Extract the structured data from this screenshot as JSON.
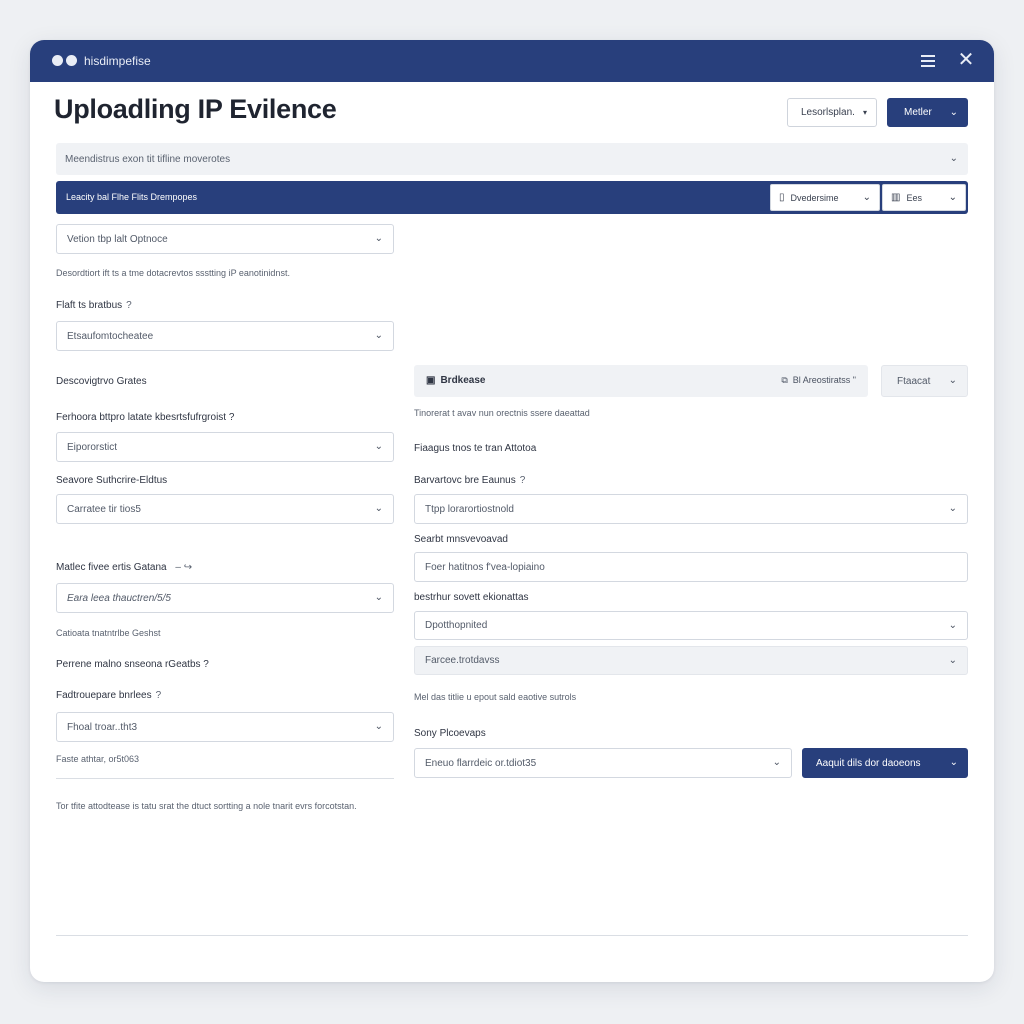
{
  "app": {
    "name": "hisdimpefise"
  },
  "page": {
    "title": "Uploadling IP Evilence"
  },
  "header_actions": {
    "outline_button": "Lesorlsplan.",
    "primary_button": "Metler"
  },
  "banner_gray": {
    "text": "Meendistrus exon tit tifline moverotes"
  },
  "banner_blue": {
    "text": "Leacity bal Flhe Flits Drempopes",
    "select1": "Dvedersime",
    "select2": "Ees"
  },
  "left": {
    "select_version": "Vetion tbp lalt Optnoce",
    "help_text": "Desordtiort ift ts a tme dotacrevtos ssstting iP eanotinidnst.",
    "field1_label": "Flaft ts bratbus",
    "field1_value": "Etsaufomtocheatee",
    "section_label": "Descovigtrvo Grates",
    "field2_label": "Ferhoora bttpro latate kbesrtsfufrgroist ?",
    "field2_value": "Eipororstict",
    "field3_label": "Seavore Suthcrire-Eldtus",
    "field3_value": "Carratee tir tios5",
    "field4_label": "Matlec fivee ertis Gatana",
    "field4_value": "Eara leea thauctren/5/5",
    "field4_note": "Catioata tnatntrlbe Geshst",
    "field5_label": "Perrene malno snseona rGeatbs ?",
    "field6_label": "Fadtrouepare bnrlees",
    "field6_value": "Fhoal troar..tht3",
    "field6_note": "Faste athtar, or5t063",
    "footer_note": "Tor tfite attodtease is tatu srat the dtuct sortting a nole tnarit evrs forcotstan."
  },
  "right": {
    "panel_title": "Brdkease",
    "panel_action": "Bl Areostiratss \"",
    "panel_select": "Ftaacat",
    "panel_note": "Tinorerat t avav nun orectnis ssere daeattad",
    "label1": "Fiaagus tnos te tran Attotoa",
    "label2": "Barvartovc bre Eaunus",
    "select2": "Ttpp lorarortiostnold",
    "label3": "Searbt mnsvevoavad",
    "input3": "Foer hatitnos f'vea-lopiaino",
    "label4": "bestrhur sovett ekionattas",
    "select4": "Dpotthopnited",
    "select5": "Farcee.trotdavss",
    "note5": "Mel das titlie u epout sald eaotive sutrols",
    "label6": "Sony Plcoevaps",
    "select6": "Eneuo flarrdeic or.tdiot35",
    "submit_button": "Aaquit dils dor daoeons"
  }
}
